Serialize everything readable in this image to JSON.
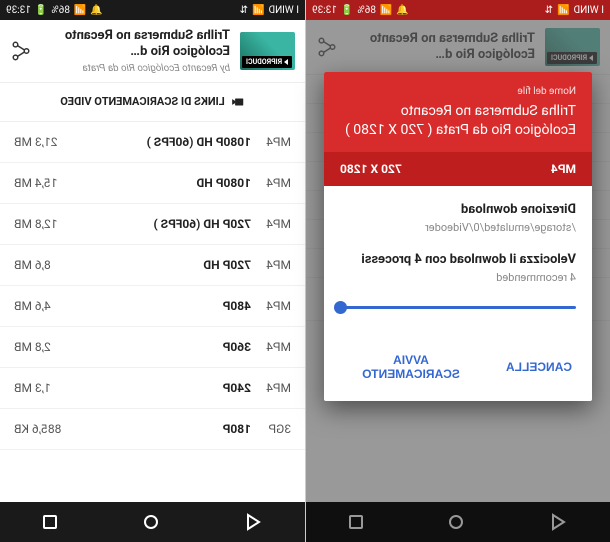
{
  "statusbar": {
    "carrier": "I WIND",
    "battery": "86%",
    "time": "13:39"
  },
  "header": {
    "title": "Trilha Submersa no Recanto Ecológico Rio d…",
    "subtitle": "by Recanto Ecológico Rio da Prata",
    "play_label": "RIPRODUCI"
  },
  "section_title": "LINKS DI SCARICAMENTO VIDEO",
  "downloads": [
    {
      "fmt": "MP4",
      "res": "1080P HD (60FPS )",
      "size": "21,3 MB"
    },
    {
      "fmt": "MP4",
      "res": "1080P HD",
      "size": "15,4 MB"
    },
    {
      "fmt": "MP4",
      "res": "720P HD (60FPS )",
      "size": "12,8 MB"
    },
    {
      "fmt": "MP4",
      "res": "720P HD",
      "size": "8,6 MB"
    },
    {
      "fmt": "MP4",
      "res": "480P",
      "size": "4,6 MB"
    },
    {
      "fmt": "MP4",
      "res": "360P",
      "size": "2,8 MB"
    },
    {
      "fmt": "MP4",
      "res": "240P",
      "size": "1,3 MB"
    },
    {
      "fmt": "3GP",
      "res": "180P",
      "size": "885,6 KB"
    }
  ],
  "left_blur_rows": [
    {
      "fmt": "",
      "res": "",
      "size": ""
    },
    {
      "fmt": "3GP",
      "res": "180P",
      "size": "885,6 KB"
    }
  ],
  "modal": {
    "file_label": "Nome del file",
    "file_title": "Trilha Submersa no Recanto Ecológico Rio da Prata ( 720 X 1280 )",
    "format": "MP4",
    "resolution": "720 X 1280",
    "dir_label": "Direzione download",
    "dir_value": "/storage/emulated/0/Videoder",
    "speed_label": "Velocizza il download con 4 processi",
    "speed_rec": "4 recommended",
    "cancel": "CANCELLA",
    "start": "AVVIA SCARICAMENTO"
  }
}
